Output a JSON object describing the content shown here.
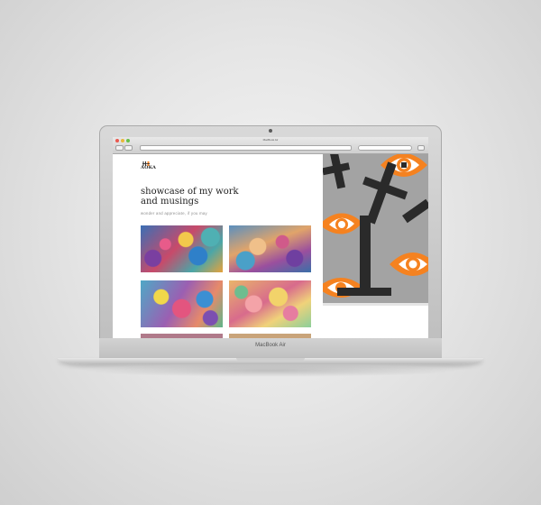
{
  "browser": {
    "window_title": "MacBook Air"
  },
  "website": {
    "logo_text": "AOKA",
    "headline_line1": "showcase of my work",
    "headline_line2": "and musings",
    "tagline": "wonder and appreciate, if you may"
  },
  "device": {
    "brand_label": "MacBook Air"
  },
  "colors": {
    "hero_background": "#9e9e9e",
    "eye_orange": "#f58220",
    "cross_black": "#2a2a2a"
  }
}
